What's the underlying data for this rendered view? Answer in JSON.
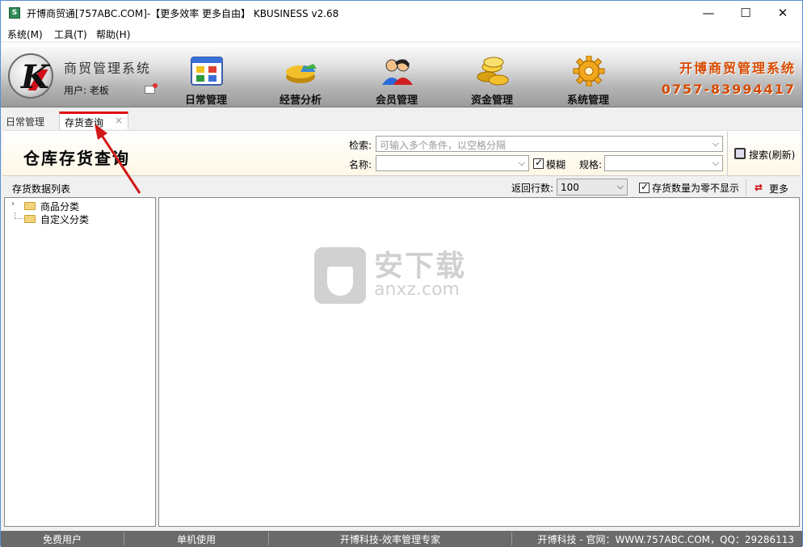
{
  "window": {
    "title": "开博商贸通[757ABC.COM]-【更多效率 更多自由】  KBUSINESS v2.68",
    "icon_text": "S",
    "controls": {
      "minimize": "—",
      "maximize": "☐",
      "close": "✕"
    }
  },
  "menubar": {
    "items": [
      "系统(M)",
      "工具(T)",
      "帮助(H)"
    ]
  },
  "header": {
    "system_name": "商贸管理系统",
    "user": "用户: 老板",
    "nav": [
      {
        "label": "日常管理",
        "icon": "daily-management-icon"
      },
      {
        "label": "经营分析",
        "icon": "business-analysis-icon"
      },
      {
        "label": "会员管理",
        "icon": "member-management-icon"
      },
      {
        "label": "资金管理",
        "icon": "fund-management-icon"
      },
      {
        "label": "系统管理",
        "icon": "system-management-icon"
      }
    ],
    "brand_name": "开博商贸管理系统",
    "brand_phone": "0757-83994417"
  },
  "tabs": {
    "daily": "日常管理",
    "stock": "存货查询",
    "close": "×"
  },
  "search": {
    "page_title": "仓库存货查询",
    "search_label": "检索:",
    "search_placeholder": "可输入多个条件，以空格分隔",
    "name_label": "名称:",
    "fuzzy_label": "模糊",
    "fuzzy_checked": true,
    "spec_label": "规格:",
    "search_button": "搜索(刷新)"
  },
  "toolbar": {
    "list_title": "存货数据列表",
    "rows_label": "返回行数:",
    "rows_value": "100",
    "hide_zero_label": "存货数量为零不显示",
    "hide_zero_checked": true,
    "more_button": "更多"
  },
  "tree": {
    "items": [
      {
        "label": "商品分类",
        "expandable": true
      },
      {
        "label": "自定义分类",
        "expandable": false
      }
    ]
  },
  "watermark": {
    "cn": "安下载",
    "en": "anxz.com"
  },
  "statusbar": {
    "user_type": "免费用户",
    "mode": "单机使用",
    "slogan": "开博科技-效率管理专家",
    "site": "开博科技 - 官网：WWW.757ABC.COM，QQ：29286113"
  },
  "colors": {
    "accent_red": "#e01010",
    "brand_orange": "#d64a00",
    "statusbar": "#6a6a6a"
  }
}
